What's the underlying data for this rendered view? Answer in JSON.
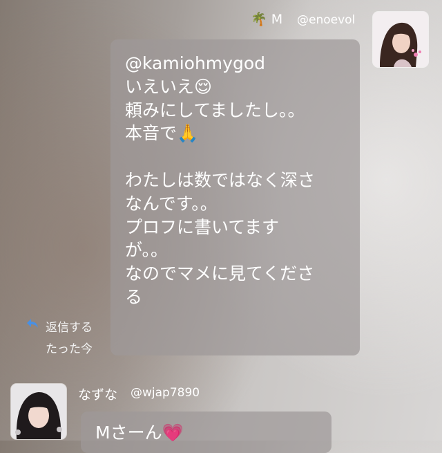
{
  "post1": {
    "author": "🌴 M",
    "handle": "@enoevol",
    "text": "@kamiohmygod\nいえいえ😌\n頼みにしてましたし。。\n本音で🙏\n\nわたしは数ではなく深さ\nなんです。。\nプロフに書いてます\nが。。\nなのでマメに見てくださ\nる",
    "reply_label": "返信する",
    "time": "たった今"
  },
  "post2": {
    "author": "なずな",
    "handle": "@wjap7890",
    "text": "Mさーん💗"
  }
}
